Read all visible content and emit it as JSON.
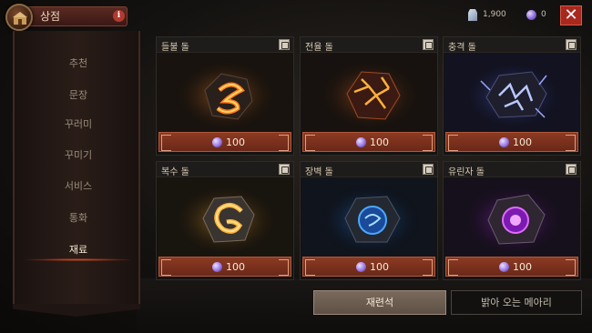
{
  "header": {
    "title": "상점",
    "info_glyph": "i",
    "gem_count": "1,900",
    "orb_count": "0",
    "close_glyph": "✕"
  },
  "sidebar": {
    "items": [
      {
        "label": "추천",
        "active": false
      },
      {
        "label": "문장",
        "active": false
      },
      {
        "label": "꾸러미",
        "active": false
      },
      {
        "label": "꾸미기",
        "active": false
      },
      {
        "label": "서비스",
        "active": false
      },
      {
        "label": "통화",
        "active": false
      },
      {
        "label": "재료",
        "active": true
      }
    ]
  },
  "cards": [
    {
      "name": "들불 돌",
      "price": "100",
      "glow": "#ff6a1a",
      "icon": "fire-stone-icon"
    },
    {
      "name": "전율 돌",
      "price": "100",
      "glow": "#ff8a2a",
      "icon": "thrill-stone-icon"
    },
    {
      "name": "충격 돌",
      "price": "100",
      "glow": "#7a8cff",
      "icon": "shock-stone-icon"
    },
    {
      "name": "복수 돌",
      "price": "100",
      "glow": "#ffb23a",
      "icon": "vengeance-stone-icon"
    },
    {
      "name": "장벽 돌",
      "price": "100",
      "glow": "#2e8cff",
      "icon": "barrier-stone-icon"
    },
    {
      "name": "유린자 돌",
      "price": "100",
      "glow": "#c23aff",
      "icon": "ravager-stone-icon"
    }
  ],
  "tabs": {
    "craft_label": "재련석",
    "memory_label": "밝아 오는 메아리"
  },
  "colors": {
    "accent_red": "#a8281e",
    "price_bar": "#8c3a22",
    "orb_purple": "#9a78e6"
  }
}
